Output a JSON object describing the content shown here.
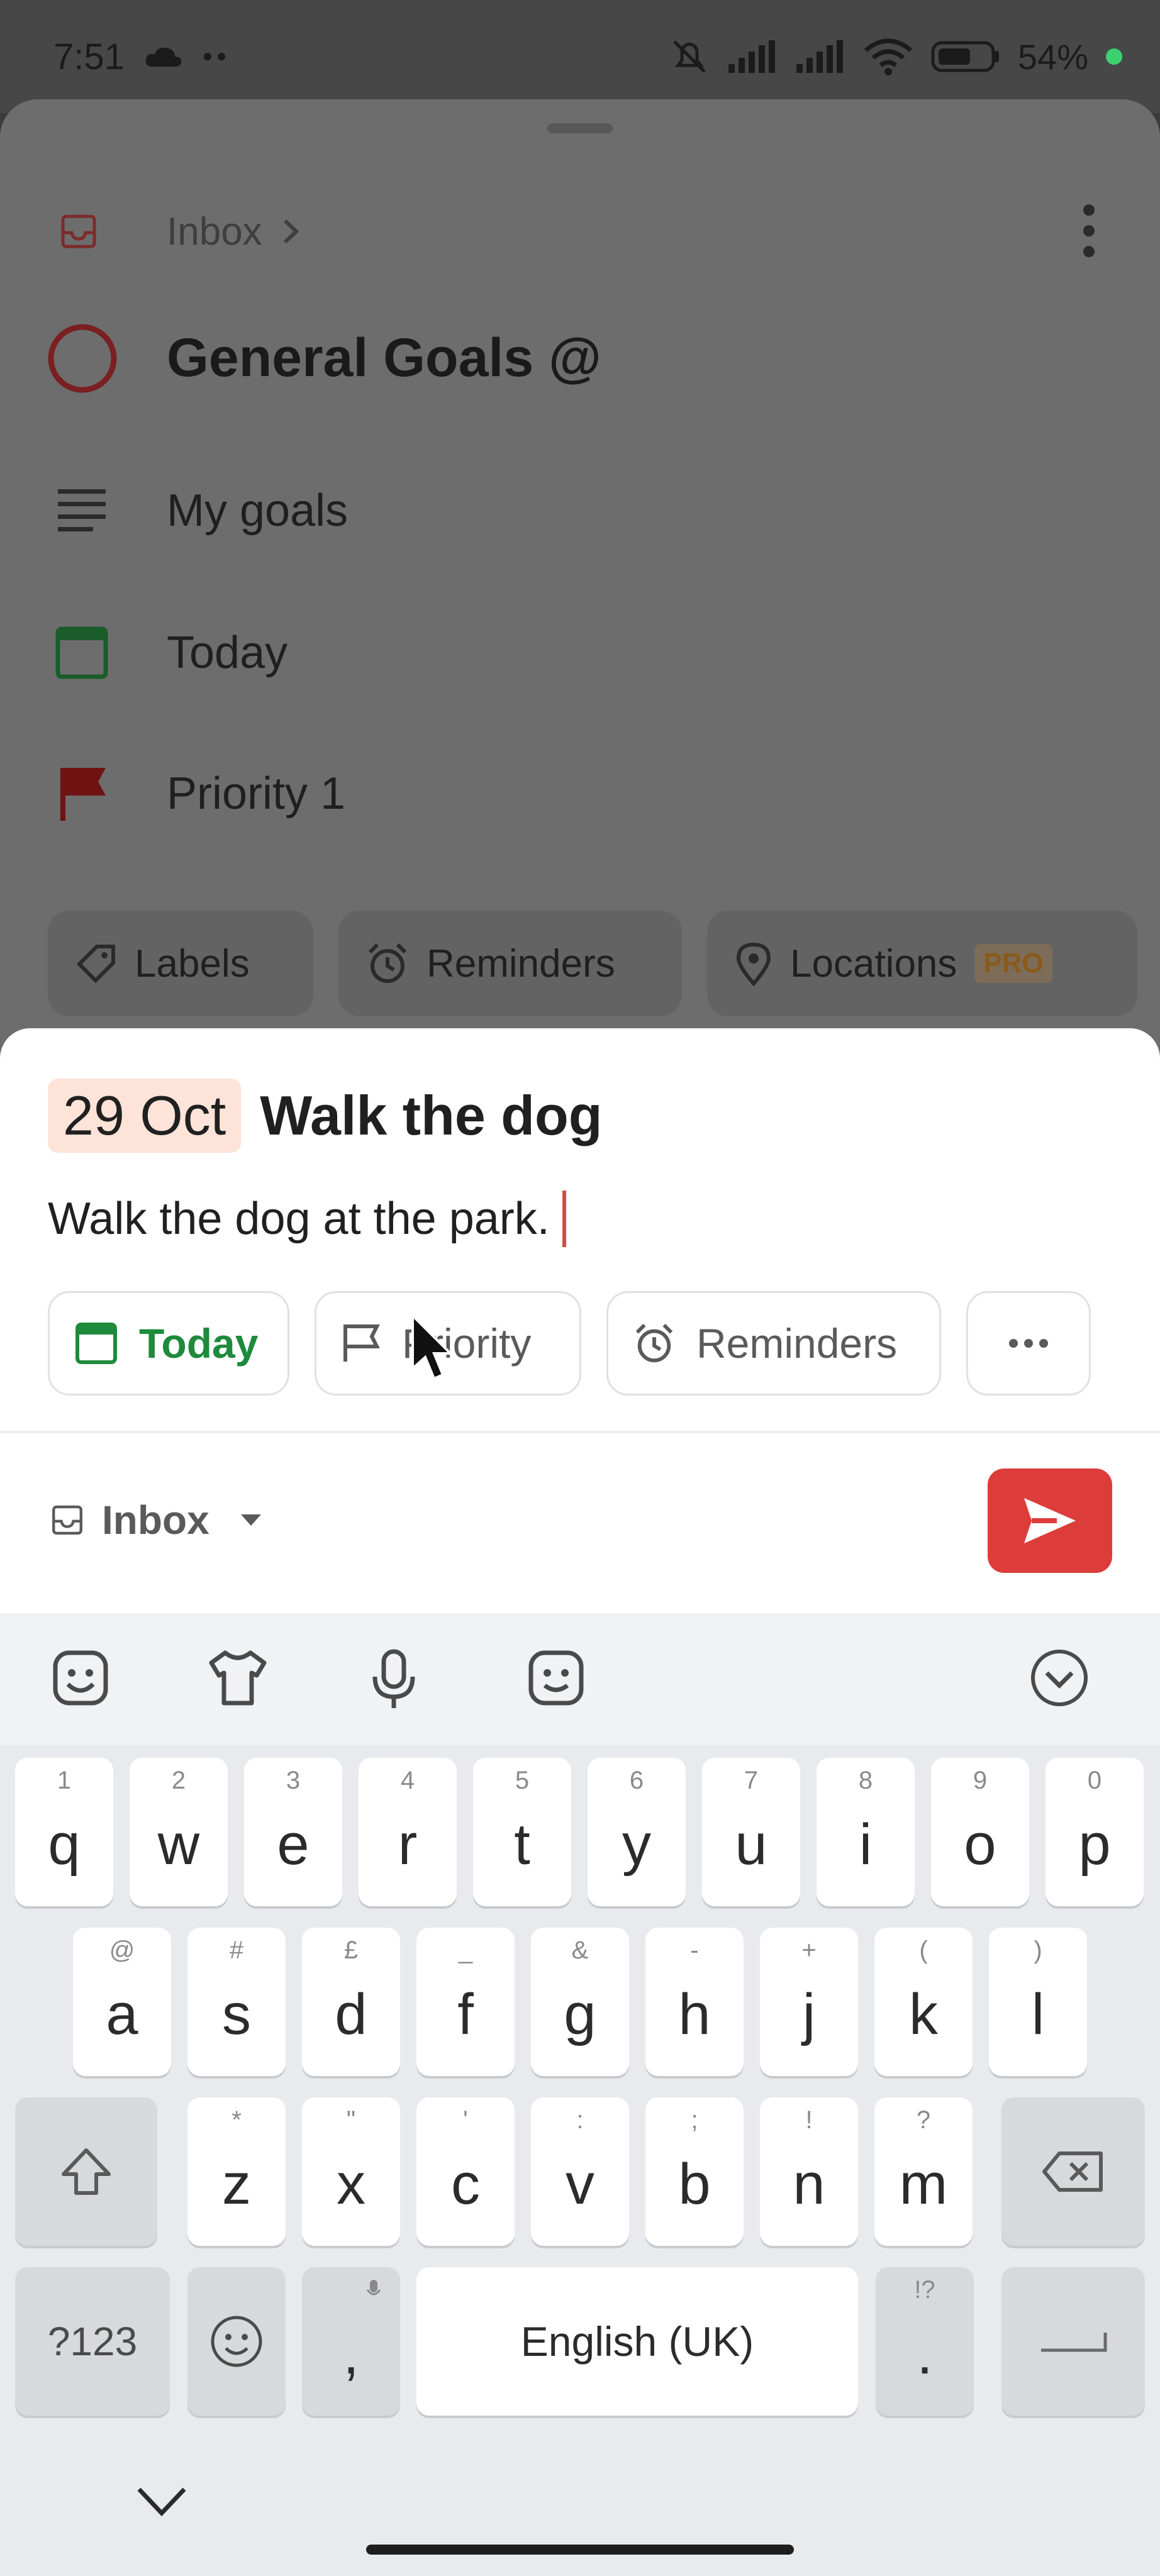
{
  "status": {
    "time": "7:51",
    "battery": "54%"
  },
  "header": {
    "breadcrumb": "Inbox"
  },
  "project_sheet": {
    "title": "General Goals @",
    "description": "My goals",
    "date": "Today",
    "priority": "Priority 1",
    "chips": {
      "labels": "Labels",
      "reminders": "Reminders",
      "locations": "Locations",
      "pro": "PRO"
    }
  },
  "composer": {
    "date_tag": "29 Oct",
    "task_name": "Walk the dog",
    "description": "Walk the dog at the park.",
    "options": {
      "today": "Today",
      "priority": "Priority",
      "reminders": "Reminders"
    },
    "project": "Inbox"
  },
  "keyboard": {
    "row1": [
      {
        "k": "q",
        "h": "1"
      },
      {
        "k": "w",
        "h": "2"
      },
      {
        "k": "e",
        "h": "3"
      },
      {
        "k": "r",
        "h": "4"
      },
      {
        "k": "t",
        "h": "5"
      },
      {
        "k": "y",
        "h": "6"
      },
      {
        "k": "u",
        "h": "7"
      },
      {
        "k": "i",
        "h": "8"
      },
      {
        "k": "o",
        "h": "9"
      },
      {
        "k": "p",
        "h": "0"
      }
    ],
    "row2": [
      {
        "k": "a",
        "h": "@"
      },
      {
        "k": "s",
        "h": "#"
      },
      {
        "k": "d",
        "h": "£"
      },
      {
        "k": "f",
        "h": "_"
      },
      {
        "k": "g",
        "h": "&"
      },
      {
        "k": "h",
        "h": "-"
      },
      {
        "k": "j",
        "h": "+"
      },
      {
        "k": "k",
        "h": "("
      },
      {
        "k": "l",
        "h": ")"
      }
    ],
    "row3": [
      {
        "k": "z",
        "h": "*"
      },
      {
        "k": "x",
        "h": "\""
      },
      {
        "k": "c",
        "h": "'"
      },
      {
        "k": "v",
        "h": ":"
      },
      {
        "k": "b",
        "h": ";"
      },
      {
        "k": "n",
        "h": "!"
      },
      {
        "k": "m",
        "h": "?"
      }
    ],
    "symbols": "?123",
    "comma": ",",
    "space": "English (UK)",
    "period": ".",
    "period_hint": "!?"
  },
  "colors": {
    "accent": "#dc3d3a",
    "today_green": "#1e8a3c",
    "priority_red": "#c81b1b"
  }
}
